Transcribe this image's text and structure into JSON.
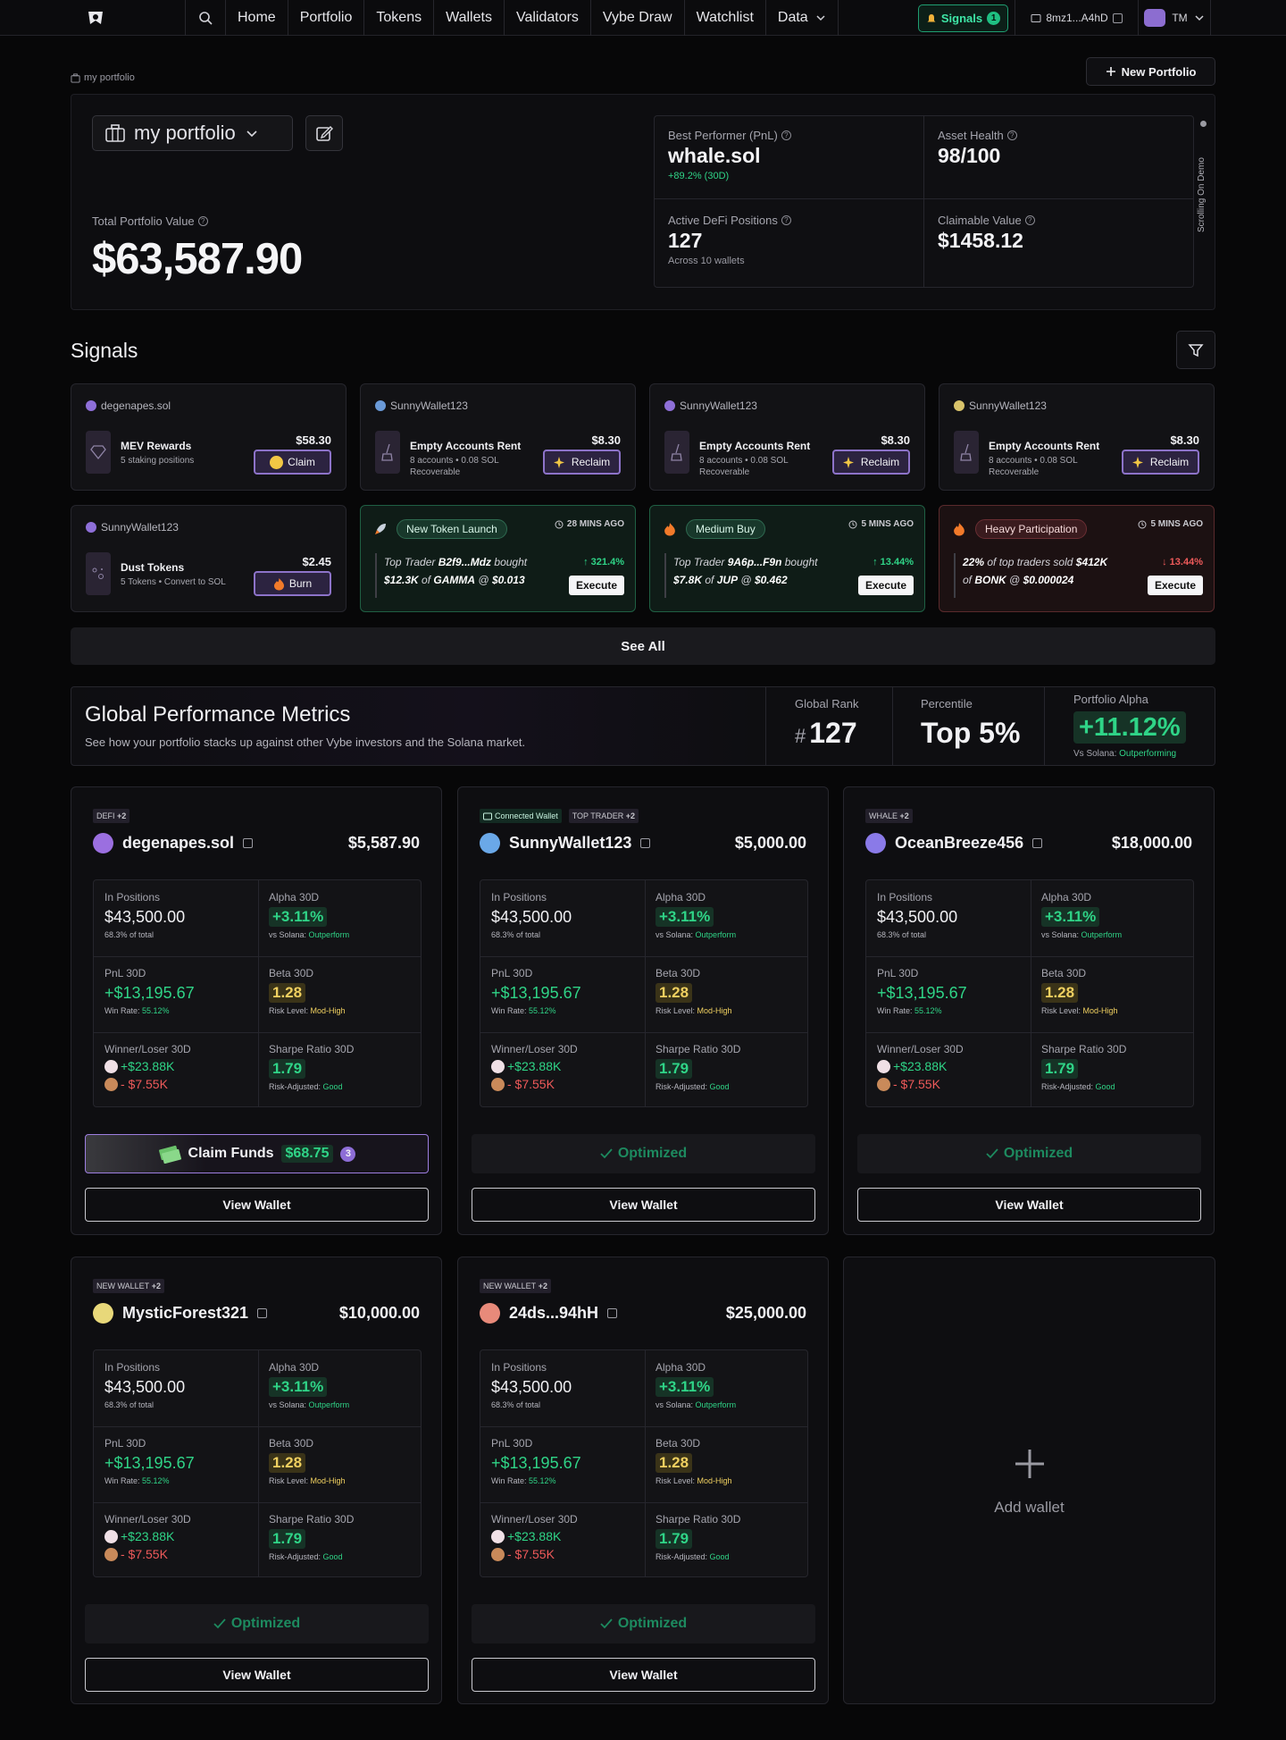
{
  "nav": {
    "links": [
      "Home",
      "Portfolio",
      "Tokens",
      "Wallets",
      "Validators",
      "Vybe Draw",
      "Watchlist",
      "Data"
    ],
    "signals_label": "Signals",
    "signals_count": "1",
    "wallet_address": "8mz1...A4hD",
    "user_initials": "TM"
  },
  "breadcrumb": "my portfolio",
  "new_portfolio_label": "New Portfolio",
  "hero": {
    "portfolio_name": "my portfolio",
    "total_label": "Total Portfolio Value",
    "total_value": "$63,587.90",
    "best_label": "Best Performer (PnL)",
    "best_value": "whale.sol",
    "best_sub": "+89.2% (30D)",
    "health_label": "Asset Health",
    "health_value": "98/100",
    "defi_label": "Active DeFi Positions",
    "defi_value": "127",
    "defi_sub": "Across 10 wallets",
    "claim_label": "Claimable Value",
    "claim_value": "$1458.12",
    "scroll_demo": "Scrolling On Demo"
  },
  "signals": {
    "title": "Signals",
    "see_all": "See All",
    "cards": [
      {
        "wallet": "degenapes.sol",
        "name": "MEV Rewards",
        "desc": "5 staking positions",
        "amount": "$58.30",
        "action": "Claim"
      },
      {
        "wallet": "SunnyWallet123",
        "name": "Empty Accounts Rent",
        "desc": "8 accounts • 0.08 SOL Recoverable",
        "amount": "$8.30",
        "action": "Reclaim"
      },
      {
        "wallet": "SunnyWallet123",
        "name": "Empty Accounts Rent",
        "desc": "8 accounts • 0.08 SOL Recoverable",
        "amount": "$8.30",
        "action": "Reclaim"
      },
      {
        "wallet": "SunnyWallet123",
        "name": "Empty Accounts Rent",
        "desc": "8 accounts • 0.08 SOL Recoverable",
        "amount": "$8.30",
        "action": "Reclaim"
      },
      {
        "wallet": "SunnyWallet123",
        "name": "Dust Tokens",
        "desc": "5 Tokens • Convert to SOL",
        "amount": "$2.45",
        "action": "Burn"
      }
    ],
    "trades": [
      {
        "tag": "New Token Launch",
        "time": "28 MINS AGO",
        "pct": "↑ 321.4%",
        "l1a": "Top Trader",
        "l1b": "B2f9...Mdz",
        "l1c": "bought",
        "l2a": "$12.3K",
        "l2b": "of",
        "l2c": "GAMMA",
        "l2d": "@",
        "l2e": "$0.013",
        "execute": "Execute"
      },
      {
        "tag": "Medium Buy",
        "time": "5 MINS AGO",
        "pct": "↑ 13.44%",
        "l1a": "Top Trader",
        "l1b": "9A6p...F9n",
        "l1c": "bought",
        "l2a": "$7.8K",
        "l2b": "of",
        "l2c": "JUP",
        "l2d": "@",
        "l2e": "$0.462",
        "execute": "Execute"
      },
      {
        "tag": "Heavy Participation",
        "time": "5 MINS AGO",
        "pct": "↓ 13.44%",
        "l1a": "22%",
        "l1b": "of top traders sold",
        "l1c": "$412K",
        "l2a": "of",
        "l2b": "BONK",
        "l2c": "@",
        "l2d": "$0.000024",
        "execute": "Execute"
      }
    ]
  },
  "gpm": {
    "title": "Global Performance Metrics",
    "desc": "See how your portfolio stacks up against other Vybe investors and the Solana market.",
    "rank_label": "Global Rank",
    "rank_hash": "#",
    "rank_value": "127",
    "pct_label": "Percentile",
    "pct_value": "Top 5%",
    "alpha_label": "Portfolio Alpha",
    "alpha_value": "+11.12%",
    "alpha_sub_a": "Vs Solana:",
    "alpha_sub_b": "Outperforming"
  },
  "cell_labels": {
    "positions": "In Positions",
    "alpha": "Alpha 30D",
    "pnl": "PnL 30D",
    "beta": "Beta 30D",
    "wl": "Winner/Loser 30D",
    "sharpe": "Sharpe Ratio 30D",
    "total_suffix": "68.3% of total",
    "vs_solana": "vs Solana:",
    "outperform": "Outperform",
    "win_rate": "Win Rate:",
    "risk_level": "Risk Level:",
    "risk_adj": "Risk-Adjusted:"
  },
  "wallets": [
    {
      "tag1": "DEFI",
      "tag2": "+2",
      "name": "degenapes.sol",
      "value": "$5,587.90",
      "positions": "$43,500.00",
      "alpha": "+3.11%",
      "pnl": "+$13,195.67",
      "win_rate": "55.12%",
      "beta": "1.28",
      "risk": "Mod-High",
      "winner": "+$23.88K",
      "loser": "- $7.55K",
      "sharpe": "1.79",
      "sharpe_note": "Good",
      "action": "Claim Funds",
      "claim_amount": "$68.75",
      "claim_count": "3",
      "view": "View Wallet"
    },
    {
      "tag0": "Connected Wallet",
      "tag1": "TOP TRADER",
      "tag2": "+2",
      "name": "SunnyWallet123",
      "value": "$5,000.00",
      "positions": "$43,500.00",
      "alpha": "+3.11%",
      "pnl": "+$13,195.67",
      "win_rate": "55.12%",
      "beta": "1.28",
      "risk": "Mod-High",
      "winner": "+$23.88K",
      "loser": "- $7.55K",
      "sharpe": "1.79",
      "sharpe_note": "Good",
      "action": "Optimized",
      "view": "View Wallet"
    },
    {
      "tag1": "WHALE",
      "tag2": "+2",
      "name": "OceanBreeze456",
      "value": "$18,000.00",
      "positions": "$43,500.00",
      "alpha": "+3.11%",
      "pnl": "+$13,195.67",
      "win_rate": "55.12%",
      "beta": "1.28",
      "risk": "Mod-High",
      "winner": "+$23.88K",
      "loser": "- $7.55K",
      "sharpe": "1.79",
      "sharpe_note": "Good",
      "action": "Optimized",
      "view": "View Wallet"
    },
    {
      "tag1": "NEW WALLET",
      "tag2": "+2",
      "name": "MysticForest321",
      "value": "$10,000.00",
      "positions": "$43,500.00",
      "alpha": "+3.11%",
      "pnl": "+$13,195.67",
      "win_rate": "55.12%",
      "beta": "1.28",
      "risk": "Mod-High",
      "winner": "+$23.88K",
      "loser": "- $7.55K",
      "sharpe": "1.79",
      "sharpe_note": "Good",
      "action": "Optimized",
      "view": "View Wallet"
    },
    {
      "tag1": "NEW WALLET",
      "tag2": "+2",
      "name": "24ds...94hH",
      "value": "$25,000.00",
      "positions": "$43,500.00",
      "alpha": "+3.11%",
      "pnl": "+$13,195.67",
      "win_rate": "55.12%",
      "beta": "1.28",
      "risk": "Mod-High",
      "winner": "+$23.88K",
      "loser": "- $7.55K",
      "sharpe": "1.79",
      "sharpe_note": "Good",
      "action": "Optimized",
      "view": "View Wallet"
    }
  ],
  "add_wallet": "Add wallet",
  "colors": {
    "accent_green": "#2fd487",
    "accent_purple": "#8d73c9",
    "loss_red": "#ee5a5a",
    "beta_yellow": "#f0d060"
  }
}
